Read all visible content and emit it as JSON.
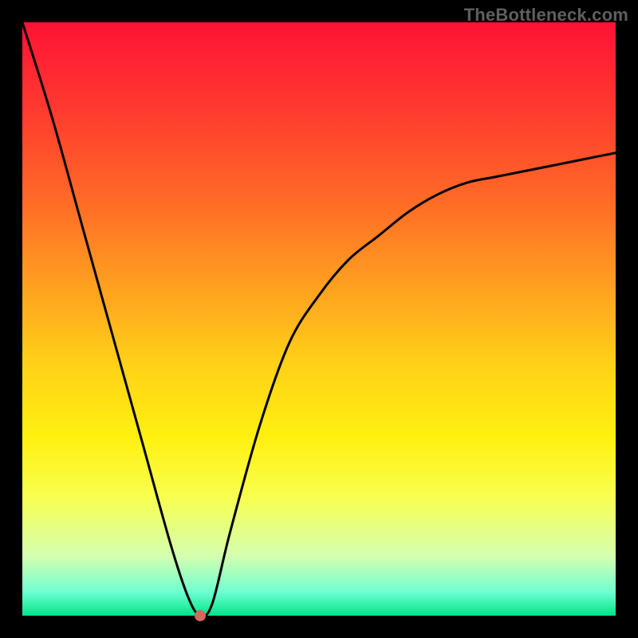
{
  "watermark": {
    "text": "TheBottleneck.com"
  },
  "chart_data": {
    "type": "line",
    "title": "",
    "xlabel": "",
    "ylabel": "",
    "xlim": [
      0,
      100
    ],
    "ylim": [
      0,
      100
    ],
    "gradient_meaning": "vertical color gradient from red (top, high bottleneck) to green (bottom, optimal)",
    "series": [
      {
        "name": "bottleneck-curve",
        "x": [
          0,
          5,
          10,
          15,
          20,
          25,
          28,
          30,
          32,
          35,
          40,
          45,
          50,
          55,
          60,
          65,
          70,
          75,
          80,
          85,
          90,
          95,
          100
        ],
        "values": [
          100,
          84,
          66,
          48,
          30,
          12,
          3,
          0,
          2,
          14,
          32,
          46,
          54,
          60,
          64,
          68,
          71,
          73,
          74,
          75,
          76,
          77,
          78
        ]
      }
    ],
    "marker": {
      "x": 30,
      "y": 0,
      "label": "optimal-point"
    },
    "colors": {
      "curve": "#000000",
      "marker": "#cf6a5c",
      "gradient_top": "#ff1235",
      "gradient_bottom": "#00e58a"
    }
  }
}
